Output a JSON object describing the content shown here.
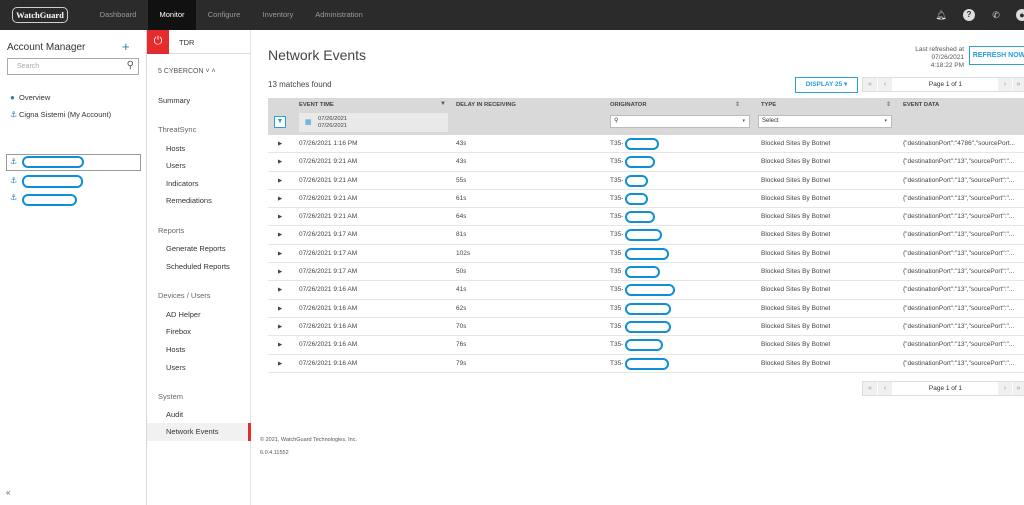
{
  "topbar": {
    "logo": "WatchGuard",
    "nav": [
      "Dashboard",
      "Monitor",
      "Configure",
      "Inventory",
      "Administration"
    ],
    "active": "Monitor",
    "icons": [
      "bell-icon",
      "help-icon",
      "phone-icon",
      "user-icon"
    ]
  },
  "account_manager": {
    "title": "Account Manager",
    "add": "+",
    "search_placeholder": "Search",
    "items": [
      {
        "label": "Overview",
        "icon": "person-icon"
      },
      {
        "label": "Cigna Sistemi (My Account)",
        "icon": "account-icon"
      }
    ],
    "collapse": "«"
  },
  "monitor_menu": {
    "tdr": "TDR",
    "account": "5 CYBERCON",
    "summary": "Summary",
    "threatsync": "ThreatSync",
    "threatsync_items": [
      "Hosts",
      "Users",
      "Indicators",
      "Remediations"
    ],
    "reports": "Reports",
    "reports_items": [
      "Generate Reports",
      "Scheduled Reports"
    ],
    "devices": "Devices / Users",
    "devices_items": [
      "AD Helper",
      "Firebox",
      "Hosts",
      "Users"
    ],
    "system": "System",
    "system_items": [
      "Audit",
      "Network Events"
    ]
  },
  "main": {
    "title": "Network Events",
    "last_refreshed_label": "Last refreshed at",
    "last_refreshed": "07/26/2021 4:18:22 PM",
    "refresh_button": "REFRESH NOW",
    "matches": "13 matches found",
    "display": "DISPLAY 25 ▾",
    "page": "Page 1 of 1",
    "columns": [
      "EVENT TIME",
      "DELAY IN RECEIVING",
      "ORIGINATOR",
      "TYPE",
      "EVENT DATA"
    ],
    "date_from": "07/26/2021",
    "date_to": "07/26/2021",
    "type_select": "Select",
    "rows": [
      {
        "time": "07/26/2021 1:16 PM",
        "delay": "43s",
        "orig": "T35-",
        "type": "Blocked Sites By Botnet",
        "data": "{\"destinationPort\":\"4786\",\"sourcePort..."
      },
      {
        "time": "07/26/2021 9:21 AM",
        "delay": "43s",
        "orig": "T35-",
        "type": "Blocked Sites By Botnet",
        "data": "{\"destinationPort\":\"13\",\"sourcePort\":\"..."
      },
      {
        "time": "07/26/2021 9:21 AM",
        "delay": "55s",
        "orig": "T35-",
        "type": "Blocked Sites By Botnet",
        "data": "{\"destinationPort\":\"13\",\"sourcePort\":\"..."
      },
      {
        "time": "07/26/2021 9:21 AM",
        "delay": "61s",
        "orig": "T35-",
        "type": "Blocked Sites By Botnet",
        "data": "{\"destinationPort\":\"13\",\"sourcePort\":\"..."
      },
      {
        "time": "07/26/2021 9:21 AM",
        "delay": "64s",
        "orig": "T35-",
        "type": "Blocked Sites By Botnet",
        "data": "{\"destinationPort\":\"13\",\"sourcePort\":\"..."
      },
      {
        "time": "07/26/2021 9:17 AM",
        "delay": "81s",
        "orig": "T35-",
        "type": "Blocked Sites By Botnet",
        "data": "{\"destinationPort\":\"13\",\"sourcePort\":\"..."
      },
      {
        "time": "07/26/2021 9:17 AM",
        "delay": "102s",
        "orig": "T35",
        "type": "Blocked Sites By Botnet",
        "data": "{\"destinationPort\":\"13\",\"sourcePort\":\"..."
      },
      {
        "time": "07/26/2021 9:17 AM",
        "delay": "50s",
        "orig": "T35",
        "type": "Blocked Sites By Botnet",
        "data": "{\"destinationPort\":\"13\",\"sourcePort\":\"..."
      },
      {
        "time": "07/26/2021 9:16 AM",
        "delay": "41s",
        "orig": "T35-",
        "type": "Blocked Sites By Botnet",
        "data": "{\"destinationPort\":\"13\",\"sourcePort\":\"..."
      },
      {
        "time": "07/26/2021 9:16 AM",
        "delay": "62s",
        "orig": "T35",
        "type": "Blocked Sites By Botnet",
        "data": "{\"destinationPort\":\"13\",\"sourcePort\":\"..."
      },
      {
        "time": "07/26/2021 9:16 AM",
        "delay": "70s",
        "orig": "T35",
        "type": "Blocked Sites By Botnet",
        "data": "{\"destinationPort\":\"13\",\"sourcePort\":\"..."
      },
      {
        "time": "07/26/2021 9:16 AM",
        "delay": "76s",
        "orig": "T35-",
        "type": "Blocked Sites By Botnet",
        "data": "{\"destinationPort\":\"13\",\"sourcePort\":\"..."
      },
      {
        "time": "07/26/2021 9:16 AM",
        "delay": "79s",
        "orig": "T35-",
        "type": "Blocked Sites By Botnet",
        "data": "{\"destinationPort\":\"13\",\"sourcePort\":\"..."
      }
    ],
    "copyright": "© 2021, WatchGuard Technologies, Inc.",
    "version": "6.0.4.11552"
  }
}
